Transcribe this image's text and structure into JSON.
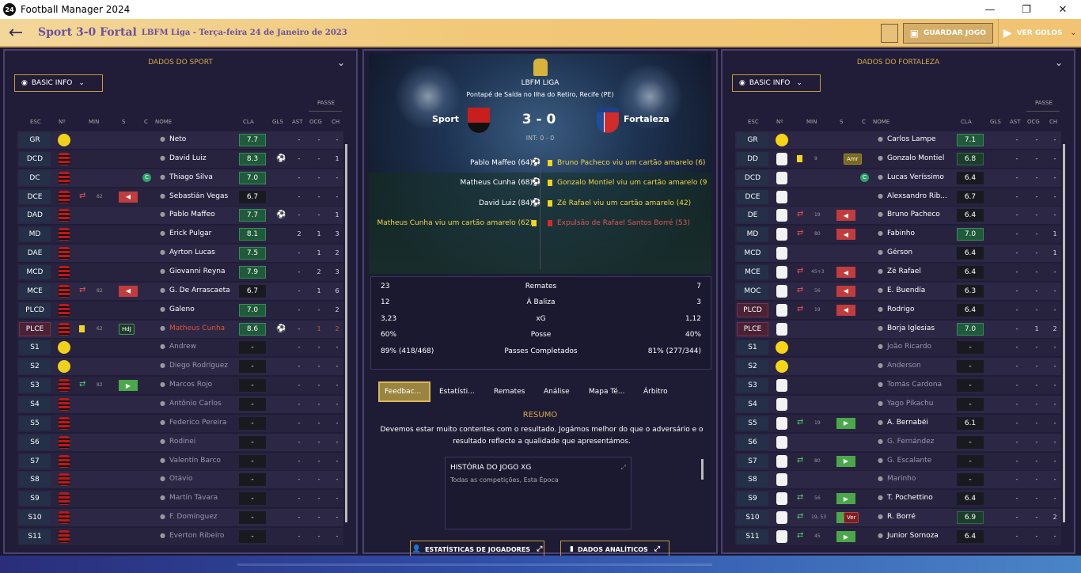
{
  "window": {
    "app_icon_text": "24",
    "title": "Football Manager 2024",
    "min": "—",
    "restore": "❐",
    "close": "✕"
  },
  "header": {
    "back": "←",
    "title": "Sport 3-0 Fortal",
    "subtitle": "LBFM Liga  -  Terça-feira 24 de Janeiro de 2023",
    "save_label": "GUARDAR JOGO",
    "save_icon": "floppy-icon",
    "goals_label": "VER GOLOS",
    "goals_icon": "play-icon"
  },
  "columns": {
    "esc": "ESC",
    "no": "Nº",
    "min": "MIN",
    "s": "S",
    "c": "C",
    "nome": "NOME",
    "cla": "CLA",
    "gls": "GLS",
    "ast": "AST",
    "ocg": "OCG",
    "ch": "CH",
    "passe": "PASSE"
  },
  "left": {
    "title": "DADOS DO SPORT",
    "basic_info": "BASIC INFO",
    "rows": [
      {
        "pos": "GR",
        "name": "Neto",
        "cla": "7.7",
        "gls": "",
        "ast": "-",
        "ocg": "-",
        "ch": "-"
      },
      {
        "pos": "DCD",
        "name": "David Luiz",
        "cla": "8.3",
        "gls": "⚽",
        "ast": "-",
        "ocg": "-",
        "ch": "1"
      },
      {
        "pos": "DC",
        "name": "Thiago Silva",
        "cla": "7.0",
        "gls": "",
        "ast": "-",
        "ocg": "-",
        "ch": "-",
        "cap": "C"
      },
      {
        "pos": "DCE",
        "name": "Sebastián Vegas",
        "cla": "6.7",
        "gls": "",
        "ast": "-",
        "ocg": "-",
        "ch": "-",
        "min": "82"
      },
      {
        "pos": "DAD",
        "name": "Pablo Maffeo",
        "cla": "7.7",
        "gls": "⚽",
        "ast": "-",
        "ocg": "-",
        "ch": "1"
      },
      {
        "pos": "MD",
        "name": "Erick Pulgar",
        "cla": "8.1",
        "gls": "",
        "ast": "2",
        "ocg": "1",
        "ch": "3"
      },
      {
        "pos": "DAE",
        "name": "Ayrton Lucas",
        "cla": "7.5",
        "gls": "",
        "ast": "-",
        "ocg": "1",
        "ch": "2"
      },
      {
        "pos": "MCD",
        "name": "Giovanni Reyna",
        "cla": "7.9",
        "gls": "",
        "ast": "-",
        "ocg": "2",
        "ch": "3"
      },
      {
        "pos": "MCE",
        "name": "G. De Arrascaeta",
        "cla": "6.7",
        "gls": "",
        "ast": "-",
        "ocg": "1",
        "ch": "6",
        "min": "82"
      },
      {
        "pos": "PLCD",
        "name": "Galeno",
        "cla": "7.0",
        "gls": "",
        "ast": "-",
        "ocg": "-",
        "ch": "2"
      },
      {
        "pos": "PLCE",
        "name": "Matheus Cunha",
        "cla": "8.6",
        "gls": "⚽",
        "ast": "-",
        "ocg": "1",
        "ch": "2",
        "min": "62",
        "tag": "HdJ"
      },
      {
        "pos": "S1",
        "name": "Andrew",
        "cla": "-",
        "gls": "",
        "ast": "-",
        "ocg": "-",
        "ch": "-"
      },
      {
        "pos": "S2",
        "name": "Diego Rodríguez",
        "cla": "-",
        "gls": "",
        "ast": "-",
        "ocg": "-",
        "ch": "-"
      },
      {
        "pos": "S3",
        "name": "Marcos Rojo",
        "cla": "-",
        "gls": "",
        "ast": "-",
        "ocg": "-",
        "ch": "-",
        "min": "82"
      },
      {
        "pos": "S4",
        "name": "Antônio Carlos",
        "cla": "-",
        "gls": "",
        "ast": "-",
        "ocg": "-",
        "ch": "-"
      },
      {
        "pos": "S5",
        "name": "Federico Pereira",
        "cla": "-",
        "gls": "",
        "ast": "-",
        "ocg": "-",
        "ch": "-"
      },
      {
        "pos": "S6",
        "name": "Rodinei",
        "cla": "-",
        "gls": "",
        "ast": "-",
        "ocg": "-",
        "ch": "-"
      },
      {
        "pos": "S7",
        "name": "Valentín Barco",
        "cla": "-",
        "gls": "",
        "ast": "-",
        "ocg": "-",
        "ch": "-"
      },
      {
        "pos": "S8",
        "name": "Otávio",
        "cla": "-",
        "gls": "",
        "ast": "-",
        "ocg": "-",
        "ch": "-"
      },
      {
        "pos": "S9",
        "name": "Martín Távara",
        "cla": "-",
        "gls": "",
        "ast": "-",
        "ocg": "-",
        "ch": "-"
      },
      {
        "pos": "S10",
        "name": "F. Domínguez",
        "cla": "-",
        "gls": "",
        "ast": "-",
        "ocg": "-",
        "ch": "-"
      },
      {
        "pos": "S11",
        "name": "Everton Ribeiro",
        "cla": "-",
        "gls": "",
        "ast": "-",
        "ocg": "-",
        "ch": "-"
      }
    ]
  },
  "right": {
    "title": "DADOS DO FORTALEZA",
    "basic_info": "BASIC INFO",
    "rows": [
      {
        "pos": "GR",
        "name": "Carlos Lampe",
        "cla": "7.1",
        "ast": "-",
        "ocg": "-",
        "ch": "-"
      },
      {
        "pos": "DD",
        "name": "Gonzalo Montiel",
        "cla": "6.8",
        "ast": "-",
        "ocg": "-",
        "ch": "-",
        "num": "9",
        "tag": "Amr"
      },
      {
        "pos": "DCD",
        "name": "Lucas Veríssimo",
        "cla": "6.4",
        "ast": "-",
        "ocg": "-",
        "ch": "-",
        "cap": "C"
      },
      {
        "pos": "DCE",
        "name": "Alexsandro Rib...",
        "cla": "6.7",
        "ast": "-",
        "ocg": "-",
        "ch": "-"
      },
      {
        "pos": "DE",
        "name": "Bruno Pacheco",
        "cla": "6.4",
        "ast": "-",
        "ocg": "-",
        "ch": "-",
        "min": "19"
      },
      {
        "pos": "MD",
        "name": "Fabinho",
        "cla": "7.0",
        "ast": "-",
        "ocg": "-",
        "ch": "1",
        "min": "80"
      },
      {
        "pos": "MCD",
        "name": "Gérson",
        "cla": "6.4",
        "ast": "-",
        "ocg": "-",
        "ch": "1"
      },
      {
        "pos": "MCE",
        "name": "Zé Rafael",
        "cla": "6.4",
        "ast": "-",
        "ocg": "-",
        "ch": "-",
        "min": "45+3"
      },
      {
        "pos": "MOC",
        "name": "E. Buendía",
        "cla": "6.3",
        "ast": "-",
        "ocg": "-",
        "ch": "-",
        "min": "56"
      },
      {
        "pos": "PLCD",
        "name": "Rodrigo",
        "cla": "6.4",
        "ast": "-",
        "ocg": "-",
        "ch": "-",
        "min": "19"
      },
      {
        "pos": "PLCE",
        "name": "Borja Iglesias",
        "cla": "7.0",
        "ast": "-",
        "ocg": "1",
        "ch": "2"
      },
      {
        "pos": "S1",
        "name": "João Ricardo",
        "cla": "-",
        "ast": "-",
        "ocg": "-",
        "ch": "-"
      },
      {
        "pos": "S2",
        "name": "Anderson",
        "cla": "-",
        "ast": "-",
        "ocg": "-",
        "ch": "-"
      },
      {
        "pos": "S3",
        "name": "Tomás Cardona",
        "cla": "-",
        "ast": "-",
        "ocg": "-",
        "ch": "-"
      },
      {
        "pos": "S4",
        "name": "Yago Pikachu",
        "cla": "-",
        "ast": "-",
        "ocg": "-",
        "ch": "-"
      },
      {
        "pos": "S5",
        "name": "A. Bernabéi",
        "cla": "6.1",
        "ast": "-",
        "ocg": "-",
        "ch": "-",
        "min": "19"
      },
      {
        "pos": "S6",
        "name": "G. Fernández",
        "cla": "-",
        "ast": "-",
        "ocg": "-",
        "ch": "-"
      },
      {
        "pos": "S7",
        "name": "G. Escalante",
        "cla": "-",
        "ast": "-",
        "ocg": "-",
        "ch": "-",
        "min": "80"
      },
      {
        "pos": "S8",
        "name": "Marinho",
        "cla": "-",
        "ast": "-",
        "ocg": "-",
        "ch": "-"
      },
      {
        "pos": "S9",
        "name": "T. Pochettino",
        "cla": "6.4",
        "ast": "-",
        "ocg": "-",
        "ch": "-",
        "min": "56"
      },
      {
        "pos": "S10",
        "name": "R. Borré",
        "cla": "6.9",
        "ast": "-",
        "ocg": "-",
        "ch": "2",
        "min": "19, 53",
        "tag": "Ver"
      },
      {
        "pos": "S11",
        "name": "Junior Sornoza",
        "cla": "6.4",
        "ast": "-",
        "ocg": "-",
        "ch": "-",
        "min": "45"
      }
    ]
  },
  "match": {
    "league": "LBFM LIGA",
    "venue": "Pontapé de Saída no Ilha do Retiro, Recife (PE)",
    "home": "Sport",
    "away": "Fortaleza",
    "score": "3 - 0",
    "ht": "INT: 0 - 0",
    "events_left": [
      "Pablo Maffeo (64)",
      "Matheus Cunha (68)",
      "David Luiz (84)",
      "Matheus Cunha viu um cartão amarelo (62)"
    ],
    "events_right": [
      "Bruno Pacheco viu um cartão amarelo (6)",
      "Gonzalo Montiel viu um cartão amarelo (9",
      "Zé Rafael viu um cartão amarelo (42)",
      "Expulsão de Rafael Santos Borré (53)"
    ]
  },
  "stats": [
    {
      "l": "23",
      "m": "Remates",
      "r": "7"
    },
    {
      "l": "12",
      "m": "À Baliza",
      "r": "3"
    },
    {
      "l": "3,23",
      "m": "xG",
      "r": "1,12"
    },
    {
      "l": "60%",
      "m": "Posse",
      "r": "40%"
    },
    {
      "l": "89% (418/468)",
      "m": "Passes Completados",
      "r": "81% (277/344)"
    }
  ],
  "tabs": [
    "Feedbac...",
    "Estatísti...",
    "Remates",
    "Análise",
    "Mapa Té...",
    "Árbitro"
  ],
  "resumo": {
    "title": "RESUMO",
    "text": "Devemos estar muito contentes com o resultado. Jogámos melhor do que o adversário e o resultado reflecte a qualidade que apresentámos."
  },
  "xg": {
    "title": "HISTÓRIA DO JOGO XG",
    "sub": "Todas as competições, Esta Época"
  },
  "buttons": {
    "player_stats": "ESTATÍSTICAS DE JOGADORES",
    "analytics": "DADOS ANALÍTICOS"
  }
}
